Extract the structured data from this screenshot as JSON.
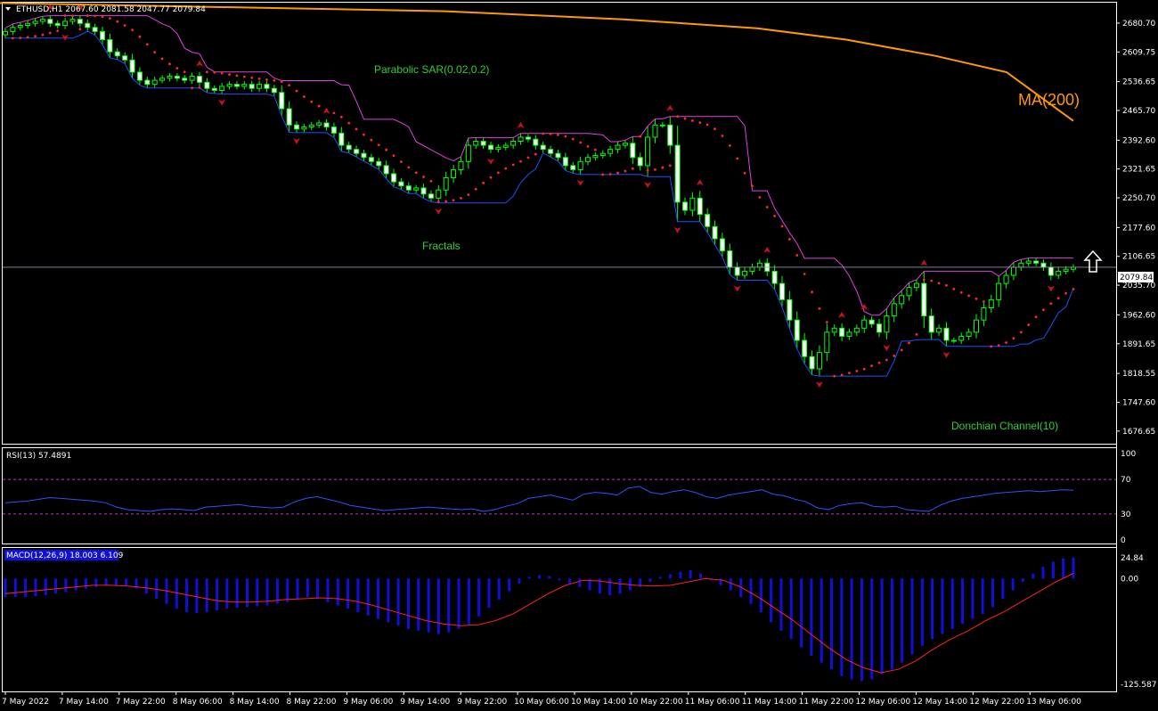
{
  "chart_data": {
    "type": "line",
    "symbol_header": "ETHUSD,H1  2067.60 2081.58 2047.77 2079.84",
    "price_label": "2079.84",
    "colors": {
      "background": "#000000",
      "panel_border": "#ffffff",
      "candle_up": "#000000",
      "candle_down": "#ffffff",
      "candle_wick": "#00ff00",
      "sar": "#ff2a2a",
      "ma": "#ff9900",
      "donchian_upper": "#e040e0",
      "donchian_lower": "#1e50ff",
      "fractal": "#cc1020",
      "rsi": "#3050ff",
      "rsi_levels": "#cc33cc",
      "macd_hist": "#1010dd",
      "macd_signal": "#ff2020",
      "annotation": "#32cd32"
    },
    "annotations": {
      "sar": "Parabolic SAR(0.02,0.2)",
      "fractals": "Fractals",
      "donchian": "Donchian Channel(10)",
      "ma": "MA(200)"
    },
    "price_axis": {
      "ylim": [
        1650,
        2720
      ],
      "ticks": [
        "2680.70",
        "2609.75",
        "2536.65",
        "2465.70",
        "2392.60",
        "2321.65",
        "2250.70",
        "2177.60",
        "2106.65",
        "2035.70",
        "1962.60",
        "1891.65",
        "1818.55",
        "1747.60",
        "1676.65"
      ]
    },
    "x_ticks": [
      "7 May 2022",
      "7 May 14:00",
      "7 May 22:00",
      "8 May 06:00",
      "8 May 14:00",
      "8 May 22:00",
      "9 May 06:00",
      "9 May 14:00",
      "9 May 22:00",
      "10 May 06:00",
      "10 May 14:00",
      "10 May 22:00",
      "11 May 06:00",
      "11 May 14:00",
      "11 May 22:00",
      "12 May 06:00",
      "12 May 14:00",
      "12 May 22:00",
      "13 May 06:00"
    ],
    "closes": [
      2660,
      2670,
      2675,
      2680,
      2685,
      2690,
      2680,
      2675,
      2685,
      2690,
      2680,
      2670,
      2660,
      2640,
      2610,
      2600,
      2590,
      2560,
      2540,
      2530,
      2540,
      2545,
      2550,
      2545,
      2540,
      2550,
      2535,
      2520,
      2515,
      2525,
      2530,
      2525,
      2530,
      2520,
      2530,
      2520,
      2510,
      2470,
      2430,
      2420,
      2425,
      2430,
      2435,
      2425,
      2410,
      2380,
      2370,
      2360,
      2350,
      2340,
      2330,
      2310,
      2290,
      2280,
      2270,
      2275,
      2260,
      2250,
      2270,
      2300,
      2320,
      2340,
      2380,
      2390,
      2380,
      2370,
      2375,
      2380,
      2390,
      2400,
      2395,
      2380,
      2370,
      2360,
      2350,
      2330,
      2320,
      2340,
      2350,
      2355,
      2360,
      2370,
      2380,
      2385,
      2350,
      2330,
      2400,
      2430,
      2430,
      2380,
      2240,
      2220,
      2250,
      2210,
      2180,
      2150,
      2120,
      2080,
      2060,
      2070,
      2080,
      2090,
      2070,
      2040,
      2000,
      1950,
      1900,
      1860,
      1830,
      1870,
      1920,
      1930,
      1910,
      1920,
      1930,
      1950,
      1940,
      1920,
      1960,
      1990,
      2010,
      2030,
      2040,
      1960,
      1920,
      1930,
      1900,
      1900,
      1910,
      1920,
      1950,
      1980,
      2000,
      2040,
      2060,
      2080,
      2090,
      2095,
      2090,
      2080,
      2060,
      2070,
      2075,
      2079.84
    ],
    "ma200": [
      [
        0,
        2730
      ],
      [
        300,
        2718
      ],
      [
        500,
        2710
      ],
      [
        700,
        2690
      ],
      [
        850,
        2668
      ],
      [
        950,
        2640
      ],
      [
        1050,
        2600
      ],
      [
        1130,
        2560
      ],
      [
        1205,
        2440
      ]
    ],
    "rsi": {
      "label": "RSI(13) 57.4891",
      "ylim": [
        0,
        100
      ],
      "ticks": [
        "100",
        "70",
        "30",
        "0"
      ],
      "levels": [
        30,
        70
      ],
      "values": [
        43,
        44,
        45,
        47,
        49,
        48,
        47,
        46,
        45,
        43,
        38,
        35,
        34,
        33,
        35,
        36,
        35,
        34,
        38,
        39,
        40,
        41,
        39,
        38,
        37,
        38,
        44,
        48,
        50,
        47,
        44,
        40,
        38,
        36,
        34,
        35,
        36,
        37,
        38,
        37,
        36,
        35,
        36,
        33,
        35,
        39,
        42,
        48,
        50,
        52,
        49,
        46,
        53,
        55,
        54,
        52,
        60,
        62,
        55,
        53,
        56,
        58,
        55,
        50,
        48,
        52,
        54,
        56,
        58,
        53,
        51,
        47,
        44,
        37,
        35,
        40,
        42,
        43,
        39,
        38,
        39,
        35,
        34,
        33,
        40,
        45,
        48,
        50,
        52,
        54,
        55,
        56,
        57,
        56,
        57,
        58,
        57.49
      ]
    },
    "macd": {
      "label": "MACD(12,26,9) 18.003 6.109",
      "ylim": [
        -130,
        30
      ],
      "ticks": [
        "24.84",
        "0.00",
        "-125.587"
      ],
      "hist": [
        -22,
        -22,
        -22,
        -21,
        -20,
        -18,
        -16,
        -14,
        -12,
        -10,
        -8,
        -8,
        -9,
        -12,
        -18,
        -24,
        -30,
        -36,
        -40,
        -41,
        -40,
        -38,
        -36,
        -35,
        -34,
        -33,
        -32,
        -30,
        -28,
        -24,
        -22,
        -24,
        -28,
        -32,
        -36,
        -40,
        -44,
        -48,
        -52,
        -56,
        -60,
        -62,
        -64,
        -66,
        -64,
        -60,
        -55,
        -45,
        -35,
        -25,
        -15,
        -6,
        2,
        4,
        3,
        -2,
        -6,
        -10,
        -14,
        -18,
        -20,
        -18,
        -14,
        -10,
        -4,
        2,
        5,
        8,
        10,
        6,
        -2,
        -8,
        -14,
        -22,
        -30,
        -40,
        -52,
        -62,
        -72,
        -82,
        -92,
        -100,
        -108,
        -116,
        -120,
        -122,
        -120,
        -114,
        -108,
        -100,
        -90,
        -80,
        -72,
        -66,
        -60,
        -54,
        -48,
        -42,
        -34,
        -24,
        -14,
        -4,
        6,
        14,
        20,
        24,
        24.84
      ],
      "signal": [
        -18,
        -16,
        -14,
        -12,
        -10,
        -8,
        -8,
        -9,
        -11,
        -14,
        -18,
        -22,
        -26,
        -28,
        -28,
        -27,
        -25,
        -24,
        -23,
        -24,
        -27,
        -32,
        -38,
        -44,
        -50,
        -54,
        -56,
        -55,
        -50,
        -42,
        -30,
        -18,
        -8,
        -2,
        -3,
        -6,
        -8,
        -9,
        -8,
        -4,
        0,
        -2,
        -10,
        -22,
        -36,
        -50,
        -66,
        -82,
        -96,
        -106,
        -112,
        -108,
        -98,
        -84,
        -72,
        -62,
        -50,
        -40,
        -28,
        -16,
        -4,
        6.109
      ]
    }
  }
}
